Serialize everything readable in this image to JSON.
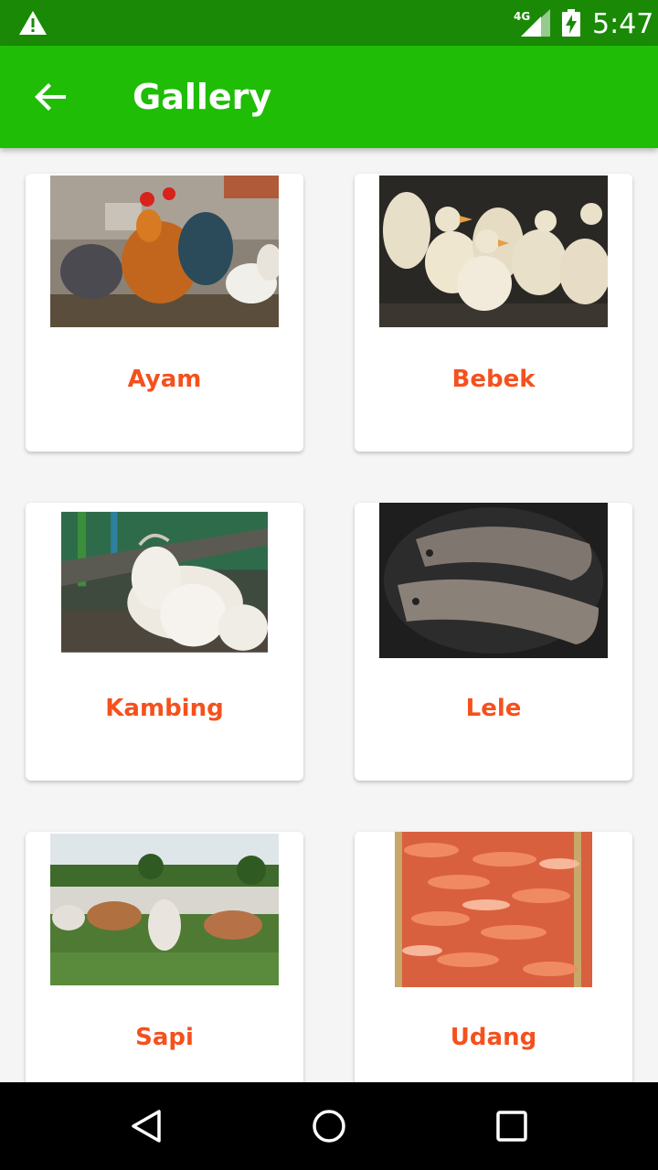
{
  "status_bar": {
    "time": "5:47",
    "network": "4G",
    "icons": [
      "warning-icon",
      "cellular-signal-icon",
      "battery-charging-icon"
    ]
  },
  "app_bar": {
    "title": "Gallery",
    "back_icon": "arrow-back-icon"
  },
  "gallery": {
    "items": [
      {
        "label": "Ayam",
        "image": "chickens-photo"
      },
      {
        "label": "Bebek",
        "image": "ducks-photo"
      },
      {
        "label": "Kambing",
        "image": "goats-photo"
      },
      {
        "label": "Lele",
        "image": "catfish-photo"
      },
      {
        "label": "Sapi",
        "image": "cattle-herd-photo"
      },
      {
        "label": "Udang",
        "image": "shrimp-photo"
      }
    ]
  },
  "nav_bar": {
    "icons": [
      "back-triangle-icon",
      "home-circle-icon",
      "recents-square-icon"
    ]
  },
  "colors": {
    "status_bar": "#1a8a06",
    "app_bar": "#1fbd06",
    "label": "#f4511e",
    "background": "#f5f5f5"
  }
}
